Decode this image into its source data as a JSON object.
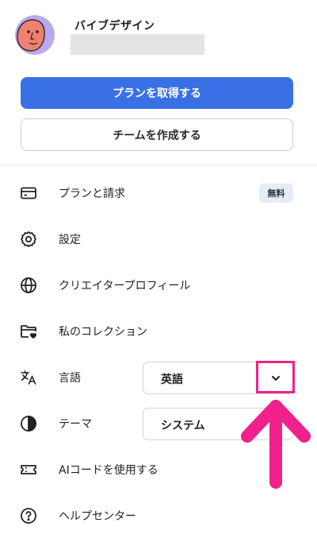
{
  "profile": {
    "name": "バイブデザイン"
  },
  "actions": {
    "get_plan_label": "プランを取得する",
    "create_team_label": "チームを作成する"
  },
  "menu": {
    "plans": {
      "label": "プランと請求",
      "badge": "無料",
      "icon": "credit-card-icon"
    },
    "settings": {
      "label": "設定",
      "icon": "gear-icon"
    },
    "creator_profile": {
      "label": "クリエイタープロフィール",
      "icon": "globe-icon"
    },
    "collection": {
      "label": "私のコレクション",
      "icon": "folder-heart-icon"
    },
    "language": {
      "label": "言語",
      "value": "英語",
      "icon": "translate-icon"
    },
    "theme": {
      "label": "テーマ",
      "value": "システム",
      "icon": "contrast-icon"
    },
    "ai_code": {
      "label": "AIコードを使用する",
      "icon": "ticket-icon"
    },
    "help": {
      "label": "ヘルプセンター",
      "icon": "help-circle-icon"
    }
  },
  "colors": {
    "primary": "#3a70e6",
    "annotation": "#f0218b",
    "badge_bg": "#e6ecf7"
  }
}
